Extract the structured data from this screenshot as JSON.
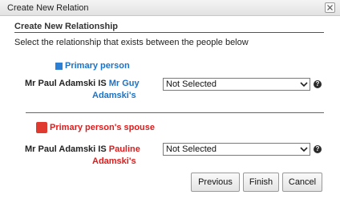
{
  "dialog": {
    "title": "Create New Relation",
    "close_icon": "close-icon"
  },
  "section": {
    "title": "Create New Relationship",
    "instruction": "Select the relationship that exists between the people below"
  },
  "primary": {
    "heading": "Primary person",
    "color": "#2b7fd4",
    "subject": "Mr Paul Adamski IS ",
    "target_line1": "Mr Guy",
    "target_line2": "Adamski's",
    "select_value": "Not Selected",
    "help_glyph": "?"
  },
  "spouse": {
    "heading": "Primary person's spouse",
    "color": "#e03a2e",
    "subject": "Mr Paul Adamski IS ",
    "target_line1": "Pauline",
    "target_line2": "Adamski's",
    "select_value": "Not Selected",
    "help_glyph": "?"
  },
  "buttons": {
    "previous": "Previous",
    "finish": "Finish",
    "cancel": "Cancel"
  }
}
